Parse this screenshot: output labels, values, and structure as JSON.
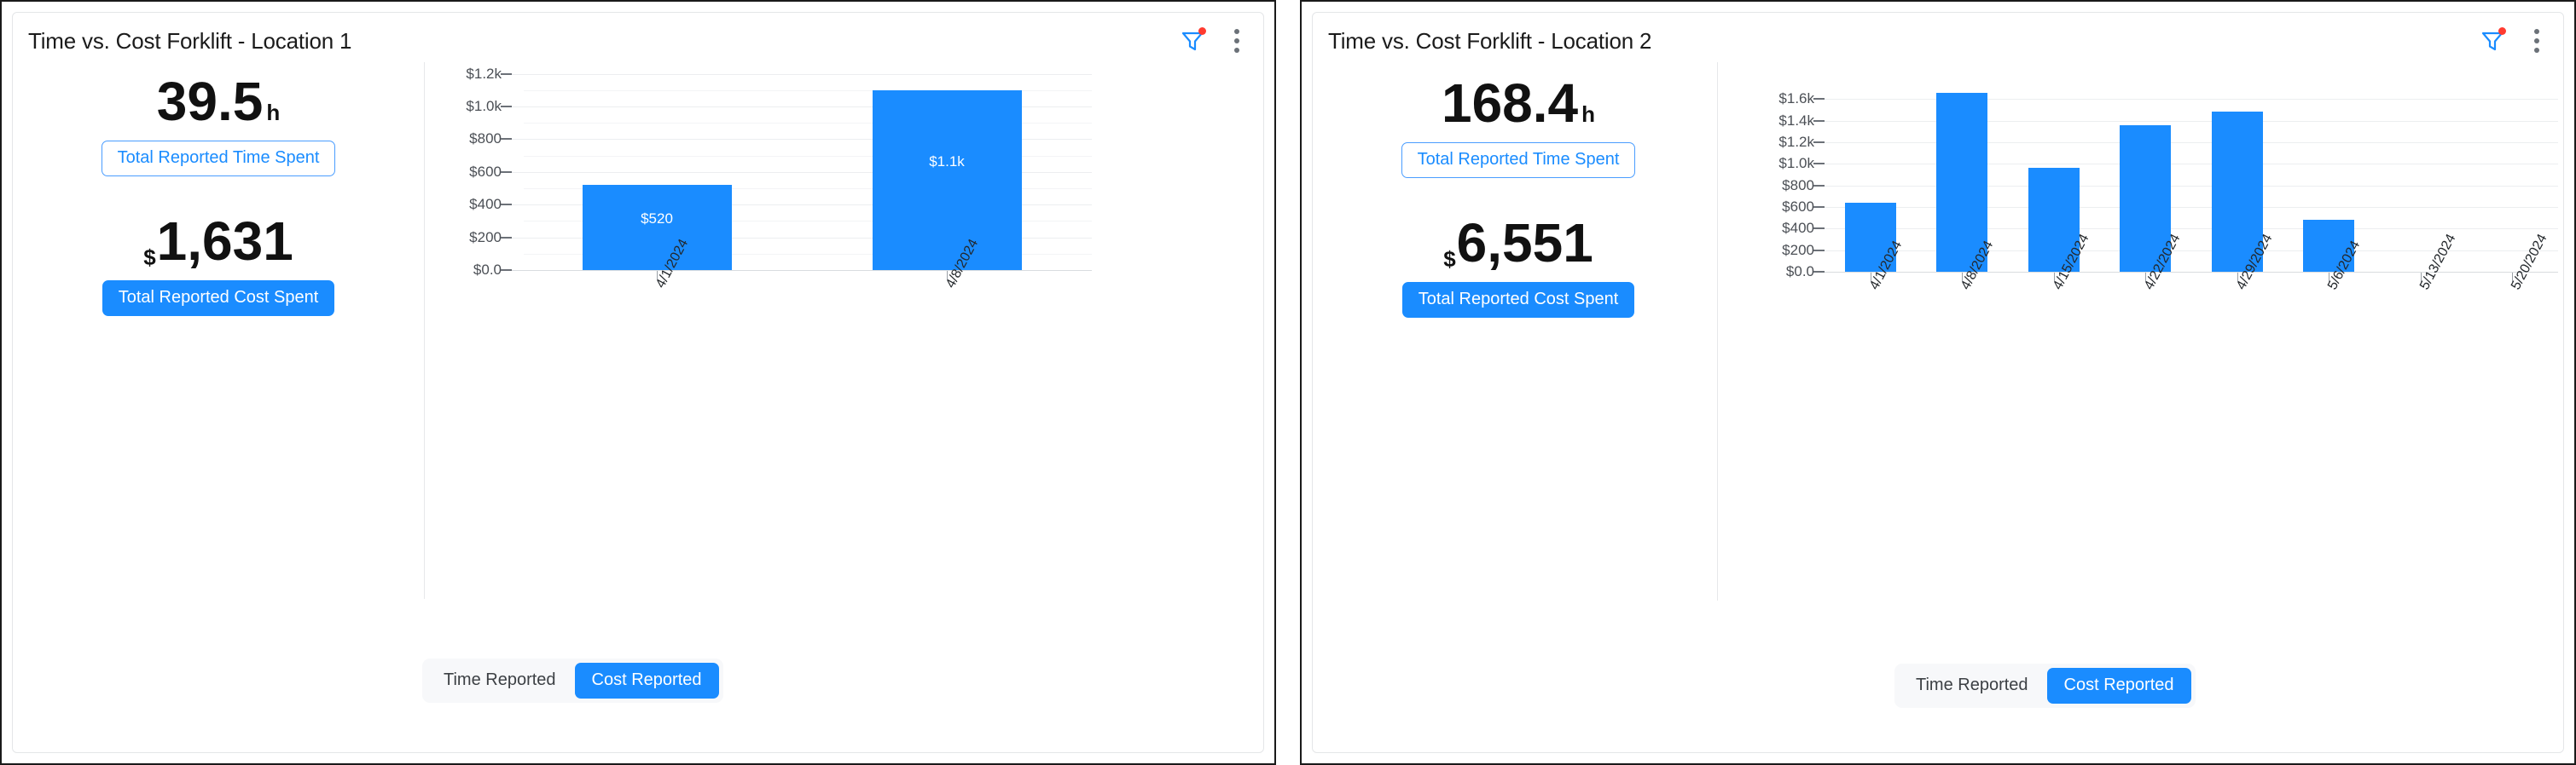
{
  "panels": [
    {
      "title": "Time vs. Cost Forklift - Location 1",
      "icons": {
        "filter": "filter-icon",
        "menu": "kebab-menu-icon"
      },
      "kpi": {
        "time_value": "39.5",
        "time_unit": "h",
        "time_label": "Total Reported Time Spent",
        "cost_prefix": "$",
        "cost_value": "1,631",
        "cost_label": "Total Reported Cost Spent"
      },
      "toggle": {
        "time_label": "Time Reported",
        "cost_label": "Cost Reported",
        "active": "Cost Reported"
      },
      "chart_data": {
        "type": "bar",
        "title": "",
        "xlabel": "",
        "ylabel": "",
        "categories": [
          "4/1/2024",
          "4/8/2024"
        ],
        "values": [
          520,
          1100
        ],
        "data_labels": [
          "$520",
          "$1.1k"
        ],
        "ytick_labels": [
          "$0.0",
          "$200",
          "$400",
          "$600",
          "$800",
          "$1.0k",
          "$1.2k"
        ],
        "ytick_values": [
          0,
          200,
          400,
          600,
          800,
          1000,
          1200
        ],
        "ylim": [
          0,
          1250
        ],
        "grid": true,
        "minor_grid": true,
        "legend": "none",
        "series_color": "#1a8cff"
      }
    },
    {
      "title": "Time vs. Cost Forklift - Location 2",
      "icons": {
        "filter": "filter-icon",
        "menu": "kebab-menu-icon"
      },
      "kpi": {
        "time_value": "168.4",
        "time_unit": "h",
        "time_label": "Total Reported Time Spent",
        "cost_prefix": "$",
        "cost_value": "6,551",
        "cost_label": "Total Reported Cost Spent"
      },
      "toggle": {
        "time_label": "Time Reported",
        "cost_label": "Cost Reported",
        "active": "Cost Reported"
      },
      "chart_data": {
        "type": "bar",
        "title": "",
        "xlabel": "",
        "ylabel": "",
        "categories": [
          "4/1/2024",
          "4/8/2024",
          "4/15/2024",
          "4/22/2024",
          "4/29/2024",
          "5/6/2024",
          "5/13/2024",
          "5/20/2024"
        ],
        "values": [
          640,
          1660,
          960,
          1360,
          1480,
          480,
          0,
          0
        ],
        "data_labels": [
          "",
          "",
          "",
          "",
          "",
          "",
          "",
          ""
        ],
        "ytick_labels": [
          "$0.0",
          "$200",
          "$400",
          "$600",
          "$800",
          "$1.0k",
          "$1.2k",
          "$1.4k",
          "$1.6k"
        ],
        "ytick_values": [
          0,
          200,
          400,
          600,
          800,
          1000,
          1200,
          1400,
          1600
        ],
        "ylim": [
          0,
          1720
        ],
        "grid": true,
        "minor_grid": false,
        "legend": "none",
        "series_color": "#1a8cff"
      }
    }
  ],
  "colors": {
    "accent": "#1a8cff",
    "badge": "#ff3b30",
    "text": "#1b1b1b",
    "grid": "#eceef0",
    "border": "#e4e6e8"
  }
}
